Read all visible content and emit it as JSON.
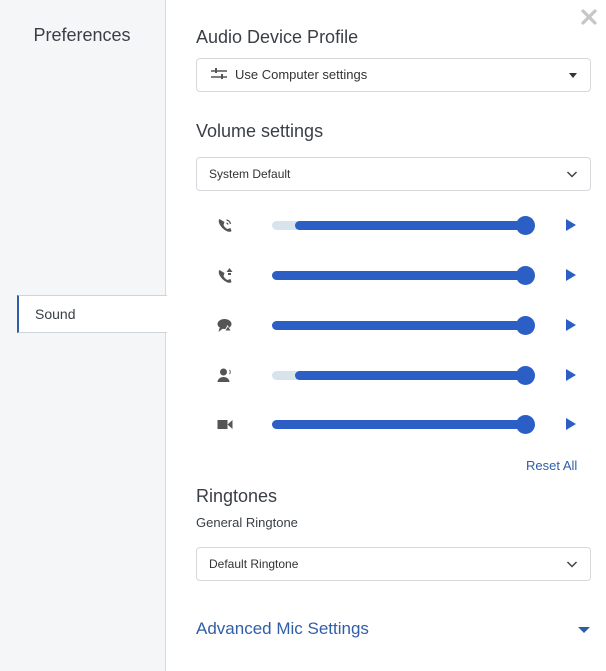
{
  "sidebar": {
    "title": "Preferences",
    "items": [
      {
        "label": "Sound",
        "active": true
      }
    ]
  },
  "header": {
    "close_icon": "close-icon"
  },
  "audio_profile": {
    "heading": "Audio Device Profile",
    "selected": "Use Computer settings",
    "icon": "tune-icon"
  },
  "volume": {
    "heading": "Volume settings",
    "device_selected": "System Default",
    "sliders": [
      {
        "icon": "phone-ringing-icon",
        "value_percent": 100,
        "indicator_percent": 9
      },
      {
        "icon": "phone-incoming-icon",
        "value_percent": 100,
        "indicator_percent": 0
      },
      {
        "icon": "chat-bubbles-icon",
        "value_percent": 100,
        "indicator_percent": 0
      },
      {
        "icon": "speaker-person-icon",
        "value_percent": 100,
        "indicator_percent": 9
      },
      {
        "icon": "video-camera-icon",
        "value_percent": 100,
        "indicator_percent": 0
      }
    ],
    "reset_label": "Reset All"
  },
  "ringtones": {
    "heading": "Ringtones",
    "general_label": "General Ringtone",
    "selected": "Default Ringtone"
  },
  "advanced": {
    "label": "Advanced Mic Settings"
  },
  "colors": {
    "accent": "#2b5fc6",
    "link": "#2f5ea8",
    "track": "#d8e4ec"
  }
}
